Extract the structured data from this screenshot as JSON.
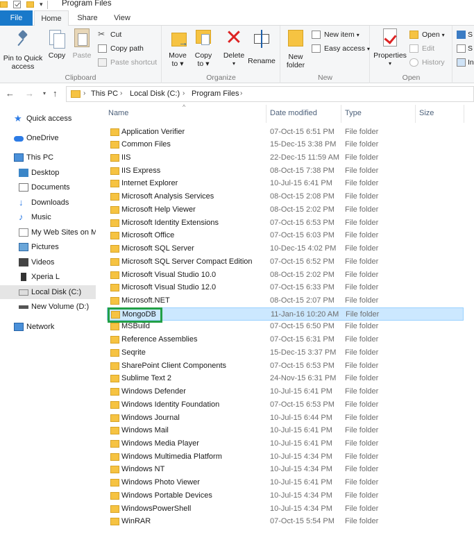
{
  "window": {
    "title": "Program Files"
  },
  "ribbon_tabs": [
    "File",
    "Home",
    "Share",
    "View"
  ],
  "ribbon": {
    "clipboard": {
      "label": "Clipboard",
      "pin_line1": "Pin to Quick",
      "pin_line2": "access",
      "copy": "Copy",
      "paste": "Paste",
      "cut": "Cut",
      "copy_path": "Copy path",
      "paste_shortcut": "Paste shortcut"
    },
    "organize": {
      "label": "Organize",
      "move_to_line1": "Move",
      "move_to_line2": "to",
      "copy_to_line1": "Copy",
      "copy_to_line2": "to",
      "delete": "Delete",
      "rename": "Rename"
    },
    "new": {
      "label": "New",
      "new_folder_line1": "New",
      "new_folder_line2": "folder",
      "new_item": "New item",
      "easy_access": "Easy access"
    },
    "open": {
      "label": "Open",
      "properties": "Properties",
      "open": "Open",
      "edit": "Edit",
      "history": "History"
    },
    "select": {
      "s1": "S",
      "s2": "S",
      "s3": "In"
    }
  },
  "address": {
    "crumbs": [
      "This PC",
      "Local Disk (C:)",
      "Program Files"
    ]
  },
  "nav": {
    "quick_access": "Quick access",
    "onedrive": "OneDrive",
    "this_pc": "This PC",
    "desktop": "Desktop",
    "documents": "Documents",
    "downloads": "Downloads",
    "music": "Music",
    "my_web_sites": "My Web Sites on M",
    "pictures": "Pictures",
    "videos": "Videos",
    "xperia": "Xperia L",
    "local_disk": "Local Disk (C:)",
    "new_volume": "New Volume (D:)",
    "network": "Network"
  },
  "columns": {
    "name": "Name",
    "date_modified": "Date modified",
    "type": "Type",
    "size": "Size"
  },
  "files": [
    {
      "name": "Application Verifier",
      "date": "07-Oct-15 6:51 PM",
      "type": "File folder"
    },
    {
      "name": "Common Files",
      "date": "15-Dec-15 3:38 PM",
      "type": "File folder"
    },
    {
      "name": "IIS",
      "date": "22-Dec-15 11:59 AM",
      "type": "File folder"
    },
    {
      "name": "IIS Express",
      "date": "08-Oct-15 7:38 PM",
      "type": "File folder"
    },
    {
      "name": "Internet Explorer",
      "date": "10-Jul-15 6:41 PM",
      "type": "File folder"
    },
    {
      "name": "Microsoft Analysis Services",
      "date": "08-Oct-15 2:08 PM",
      "type": "File folder"
    },
    {
      "name": "Microsoft Help Viewer",
      "date": "08-Oct-15 2:02 PM",
      "type": "File folder"
    },
    {
      "name": "Microsoft Identity Extensions",
      "date": "07-Oct-15 6:53 PM",
      "type": "File folder"
    },
    {
      "name": "Microsoft Office",
      "date": "07-Oct-15 6:03 PM",
      "type": "File folder"
    },
    {
      "name": "Microsoft SQL Server",
      "date": "10-Dec-15 4:02 PM",
      "type": "File folder"
    },
    {
      "name": "Microsoft SQL Server Compact Edition",
      "date": "07-Oct-15 6:52 PM",
      "type": "File folder"
    },
    {
      "name": "Microsoft Visual Studio 10.0",
      "date": "08-Oct-15 2:02 PM",
      "type": "File folder"
    },
    {
      "name": "Microsoft Visual Studio 12.0",
      "date": "07-Oct-15 6:33 PM",
      "type": "File folder"
    },
    {
      "name": "Microsoft.NET",
      "date": "08-Oct-15 2:07 PM",
      "type": "File folder"
    },
    {
      "name": "MongoDB",
      "date": "11-Jan-16 10:20 AM",
      "type": "File folder",
      "selected": true
    },
    {
      "name": "MSBuild",
      "date": "07-Oct-15 6:50 PM",
      "type": "File folder"
    },
    {
      "name": "Reference Assemblies",
      "date": "07-Oct-15 6:31 PM",
      "type": "File folder"
    },
    {
      "name": "Seqrite",
      "date": "15-Dec-15 3:37 PM",
      "type": "File folder"
    },
    {
      "name": "SharePoint Client Components",
      "date": "07-Oct-15 6:53 PM",
      "type": "File folder"
    },
    {
      "name": "Sublime Text 2",
      "date": "24-Nov-15 6:31 PM",
      "type": "File folder"
    },
    {
      "name": "Windows Defender",
      "date": "10-Jul-15 6:41 PM",
      "type": "File folder"
    },
    {
      "name": "Windows Identity Foundation",
      "date": "07-Oct-15 6:53 PM",
      "type": "File folder"
    },
    {
      "name": "Windows Journal",
      "date": "10-Jul-15 6:44 PM",
      "type": "File folder"
    },
    {
      "name": "Windows Mail",
      "date": "10-Jul-15 6:41 PM",
      "type": "File folder"
    },
    {
      "name": "Windows Media Player",
      "date": "10-Jul-15 6:41 PM",
      "type": "File folder"
    },
    {
      "name": "Windows Multimedia Platform",
      "date": "10-Jul-15 4:34 PM",
      "type": "File folder"
    },
    {
      "name": "Windows NT",
      "date": "10-Jul-15 4:34 PM",
      "type": "File folder"
    },
    {
      "name": "Windows Photo Viewer",
      "date": "10-Jul-15 6:41 PM",
      "type": "File folder"
    },
    {
      "name": "Windows Portable Devices",
      "date": "10-Jul-15 4:34 PM",
      "type": "File folder"
    },
    {
      "name": "WindowsPowerShell",
      "date": "10-Jul-15 4:34 PM",
      "type": "File folder"
    },
    {
      "name": "WinRAR",
      "date": "07-Oct-15 5:54 PM",
      "type": "File folder"
    }
  ],
  "colors": {
    "file_tab": "#1979ca",
    "selection": "#cce8ff",
    "highlight_box": "#22a046",
    "folder": "#f6c342"
  }
}
